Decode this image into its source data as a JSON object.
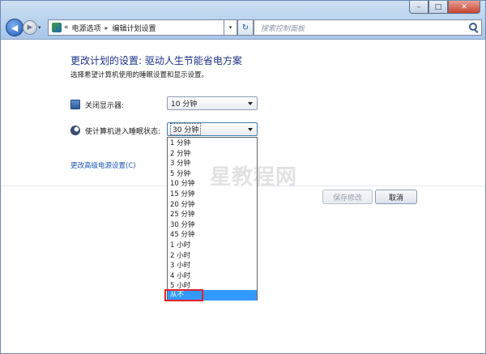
{
  "window": {
    "minimize_glyph": "–",
    "maximize_glyph": "□",
    "close_glyph": "✕"
  },
  "nav": {
    "back_glyph": "◀",
    "forward_glyph": "▶",
    "history_glyph": "▾",
    "breadcrumb_prefix": "«",
    "breadcrumb": [
      "电源选项",
      "编辑计划设置"
    ],
    "separator_glyph": "▸",
    "address_dropdown_glyph": "▾",
    "refresh_glyph": "↻",
    "search_placeholder": "搜索控制面板"
  },
  "page": {
    "title": "更改计划的设置: 驱动人生节能省电方案",
    "subtitle": "选择希望计算机使用的睡眠设置和显示设置。",
    "display_off": {
      "label": "关闭显示器:",
      "value": "10 分钟"
    },
    "sleep": {
      "label": "使计算机进入睡眠状态:",
      "value": "30 分钟",
      "options": [
        "1 分钟",
        "2 分钟",
        "3 分钟",
        "5 分钟",
        "10 分钟",
        "15 分钟",
        "20 分钟",
        "25 分钟",
        "30 分钟",
        "45 分钟",
        "1 小时",
        "2 小时",
        "3 小时",
        "4 小时",
        "5 小时",
        "从不"
      ],
      "hovered_option": "从不"
    },
    "advanced_link": "更改高级电源设置(C)",
    "save_button": "保存修改",
    "cancel_button": "取消"
  },
  "watermark": "星教程网",
  "colors": {
    "heading": "#1e3287",
    "link": "#1a56b4",
    "selection": "#3399ff",
    "highlight_box": "#e0202a"
  },
  "icons": [
    "back-arrow-icon",
    "forward-arrow-icon",
    "control-panel-icon",
    "refresh-icon",
    "search-icon",
    "monitor-icon",
    "moon-icon"
  ]
}
